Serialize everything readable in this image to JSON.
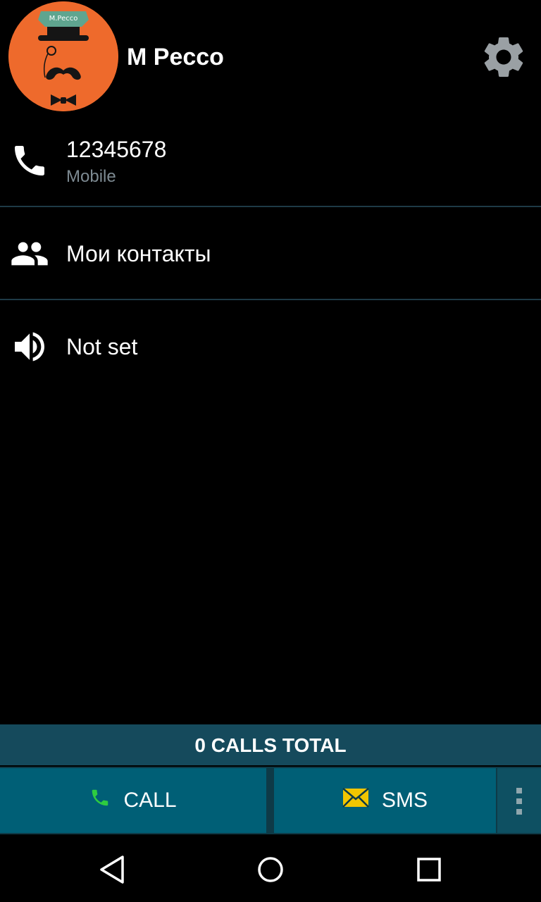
{
  "contact": {
    "name": "M Pecco",
    "avatar_text": "M.Pecco"
  },
  "colors": {
    "avatar_background": "#ee6a2c",
    "calls_banner": "#154a5c",
    "action_button": "#005f76",
    "call_icon": "#2ecc40",
    "sms_icon": "#f2c500",
    "secondary_text": "#7d8a92"
  },
  "rows": {
    "phone": {
      "icon": "phone-icon",
      "number": "12345678",
      "type": "Mobile"
    },
    "group": {
      "icon": "people-icon",
      "label": "Мои контакты"
    },
    "ringtone": {
      "icon": "volume-icon",
      "label": "Not set"
    }
  },
  "stats": {
    "calls_total": "0 CALLS TOTAL"
  },
  "actions": {
    "call_label": "CALL",
    "sms_label": "SMS"
  },
  "header": {
    "settings_icon": "gear-icon"
  },
  "navigation": {
    "back_icon": "back-triangle-icon",
    "home_icon": "home-circle-icon",
    "recents_icon": "recents-square-icon"
  }
}
